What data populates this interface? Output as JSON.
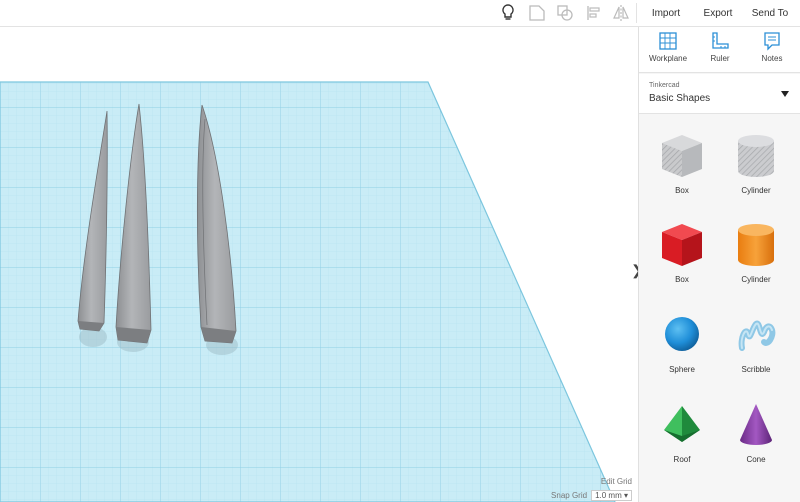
{
  "toolbar": {
    "icons": [
      "lightbulb-icon",
      "group-icon",
      "ungroup-icon",
      "align-icon",
      "mirror-icon"
    ],
    "import_label": "Import",
    "export_label": "Export",
    "send_to_label": "Send To"
  },
  "panel": {
    "tools": [
      {
        "label": "Workplane",
        "icon": "workplane-icon"
      },
      {
        "label": "Ruler",
        "icon": "ruler-icon"
      },
      {
        "label": "Notes",
        "icon": "notes-icon"
      }
    ],
    "library": {
      "provider": "Tinkercad",
      "name": "Basic Shapes"
    },
    "shapes": [
      {
        "label": "Box",
        "icon": "box-hole-icon"
      },
      {
        "label": "Cylinder",
        "icon": "cylinder-hole-icon"
      },
      {
        "label": "Box",
        "icon": "box-icon",
        "color": "#e3242b"
      },
      {
        "label": "Cylinder",
        "icon": "cylinder-icon",
        "color": "#f28b1f"
      },
      {
        "label": "Sphere",
        "icon": "sphere-icon",
        "color": "#1f8ed8"
      },
      {
        "label": "Scribble",
        "icon": "scribble-icon",
        "color": "#8fc8e6"
      },
      {
        "label": "Roof",
        "icon": "roof-icon",
        "color": "#2ea84a"
      },
      {
        "label": "Cone",
        "icon": "cone-icon",
        "color": "#8a3fa6"
      }
    ]
  },
  "viewport": {
    "edit_grid_label": "Edit Grid",
    "snap_grid_label": "Snap Grid",
    "snap_grid_value": "1.0 mm"
  },
  "colors": {
    "workplane": "#c9ecf6",
    "grid_line": "#9fd6e8",
    "shape_gray": "#a7a9ac"
  }
}
